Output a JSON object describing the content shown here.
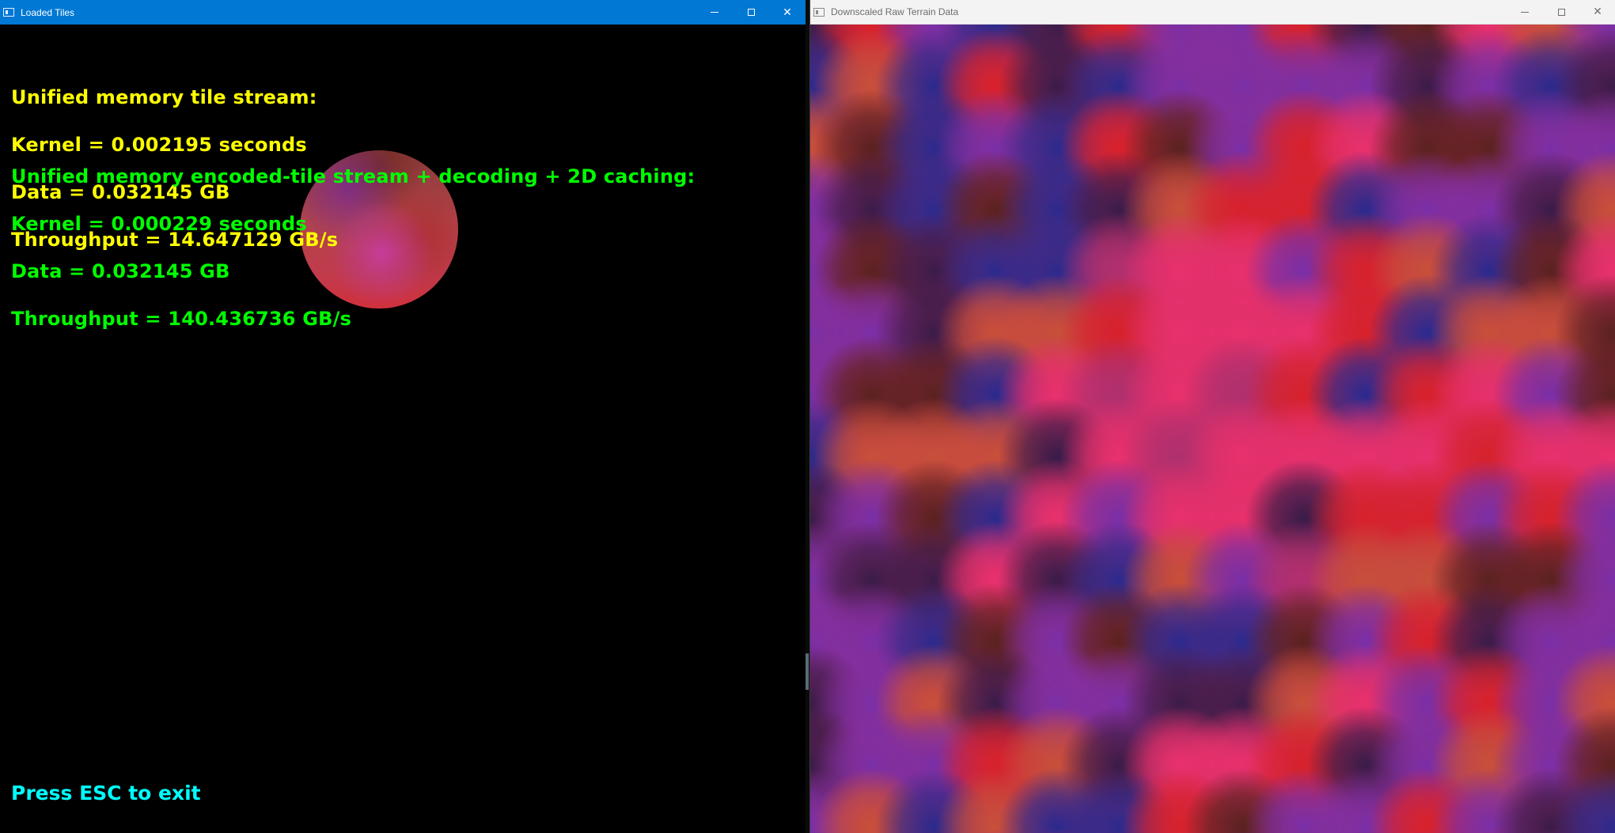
{
  "left_window": {
    "title": "Loaded Tiles",
    "caption": {
      "minimize": "minimize-icon",
      "maximize": "maximize-icon",
      "close": "✕"
    },
    "stats_unified": {
      "heading": "Unified memory tile stream:",
      "kernel": "Kernel = 0.002195 seconds",
      "data": "Data = 0.032145 GB",
      "throughput": "Throughput = 14.647129 GB/s",
      "color": "#ffff00"
    },
    "stats_encoded": {
      "heading": "Unified memory encoded-tile stream + decoding + 2D caching:",
      "kernel": "Kernel = 0.000229 seconds",
      "data": "Data = 0.032145 GB",
      "throughput": "Throughput = 140.436736 GB/s",
      "color": "#00ff00"
    },
    "hint": "Press ESC to exit",
    "hint_color": "#00ffff",
    "titlebar_color": "#0078d4"
  },
  "right_window": {
    "title": "Downscaled Raw Terrain Data",
    "caption": {
      "minimize": "minimize-icon",
      "maximize": "maximize-icon",
      "close": "✕"
    },
    "titlebar_color": "#f3f3f3",
    "terrain_palette": [
      "#e8316e",
      "#d8222c",
      "#7a2fa8",
      "#2b2a8e",
      "#5a2220",
      "#c8503a",
      "#3a1c4a",
      "#b03070"
    ]
  }
}
